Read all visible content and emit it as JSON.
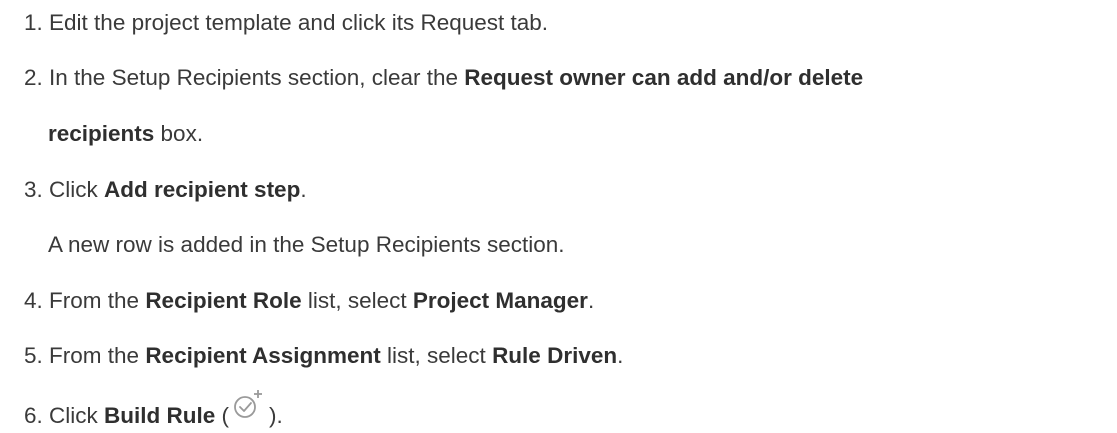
{
  "steps": [
    {
      "num": "1.",
      "text": "Edit the project template and click its Request tab."
    },
    {
      "num": "2.",
      "pre": "In the Setup Recipients section, clear the ",
      "bold": "Request owner can add and/or delete",
      "bold2": "recipients",
      "post": " box."
    },
    {
      "num": "3.",
      "pre": "Click ",
      "bold": "Add recipient step",
      "post": ".",
      "note": "A new row is added in the Setup Recipients section."
    },
    {
      "num": "4.",
      "pre": "From the ",
      "bold": "Recipient Role",
      "mid": " list, select ",
      "bold2": "Project Manager",
      "post": "."
    },
    {
      "num": "5.",
      "pre": "From the ",
      "bold": "Recipient Assignment",
      "mid": " list, select ",
      "bold2": "Rule Driven",
      "post": "."
    },
    {
      "num": "6.",
      "pre": "Click ",
      "bold": "Build Rule",
      "open": " (",
      "icon": "build-rule-icon",
      "close": ")."
    }
  ],
  "colors": {
    "text": "#3a3a3a",
    "icon": "#9a9a9a"
  }
}
